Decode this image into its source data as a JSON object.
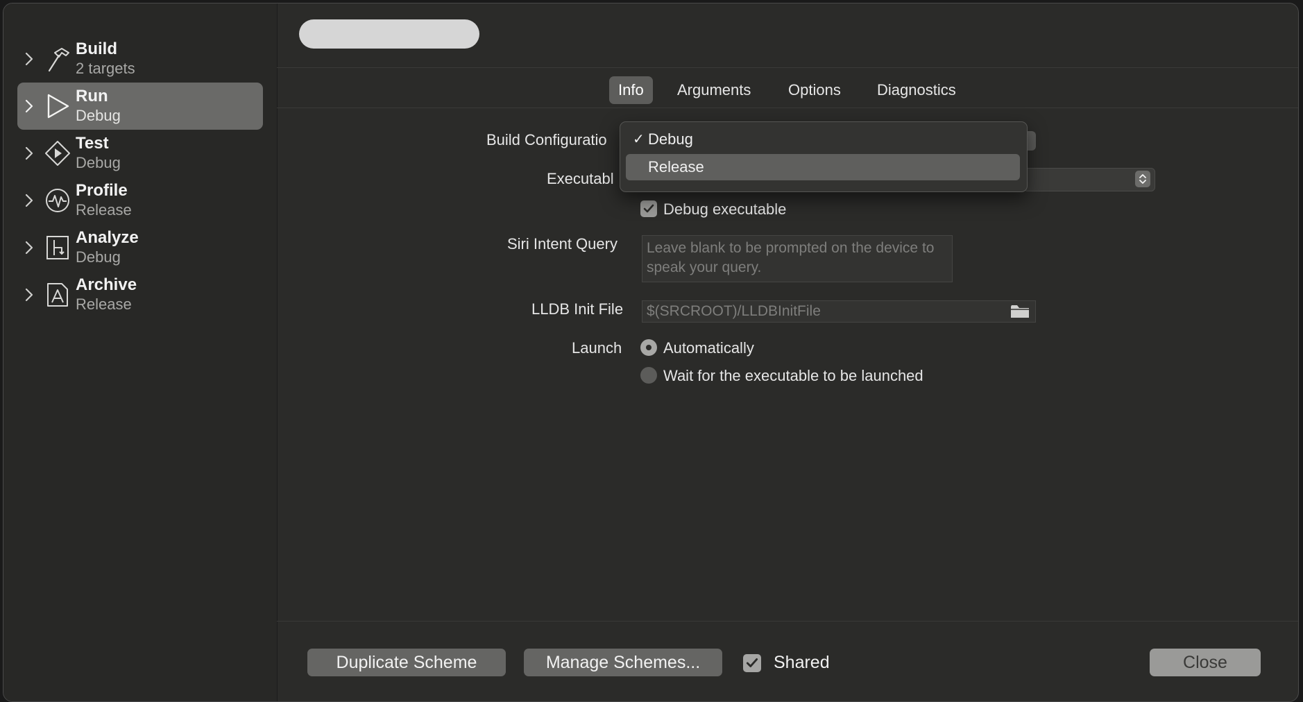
{
  "window": {
    "scheme_name": ""
  },
  "sidebar": {
    "items": [
      {
        "title": "Build",
        "subtitle": "2 targets",
        "icon": "hammer-icon",
        "selected": false
      },
      {
        "title": "Run",
        "subtitle": "Debug",
        "icon": "play-icon",
        "selected": true
      },
      {
        "title": "Test",
        "subtitle": "Debug",
        "icon": "test-diamond-icon",
        "selected": false
      },
      {
        "title": "Profile",
        "subtitle": "Release",
        "icon": "waveform-icon",
        "selected": false
      },
      {
        "title": "Analyze",
        "subtitle": "Debug",
        "icon": "analyze-icon",
        "selected": false
      },
      {
        "title": "Archive",
        "subtitle": "Release",
        "icon": "archive-icon",
        "selected": false
      }
    ]
  },
  "tabs": [
    {
      "label": "Info",
      "active": true
    },
    {
      "label": "Arguments",
      "active": false
    },
    {
      "label": "Options",
      "active": false
    },
    {
      "label": "Diagnostics",
      "active": false
    }
  ],
  "form": {
    "build_configuration_label": "Build Configuratio",
    "executable_label": "Executabl",
    "debug_executable_label": "Debug executable",
    "debug_executable_checked": true,
    "siri_label": "Siri Intent Query",
    "siri_placeholder": "Leave blank to be prompted on the device to speak your query.",
    "lldb_label": "LLDB Init File",
    "lldb_placeholder": "$(SRCROOT)/LLDBInitFile",
    "launch_label": "Launch",
    "launch_options": [
      {
        "label": "Automatically",
        "selected": true
      },
      {
        "label": "Wait for the executable to be launched",
        "selected": false
      }
    ]
  },
  "dropdown": {
    "items": [
      {
        "label": "Debug",
        "checkmark": "✓",
        "checked": true,
        "highlighted": false
      },
      {
        "label": "Release",
        "checkmark": "",
        "checked": false,
        "highlighted": true
      }
    ]
  },
  "footer": {
    "duplicate_label": "Duplicate Scheme",
    "manage_label": "Manage Schemes...",
    "shared_label": "Shared",
    "shared_checked": true,
    "close_label": "Close"
  },
  "colors": {
    "selection": "#6a6a68",
    "window_bg": "#2b2b29",
    "sidebar_bg": "#282826"
  }
}
